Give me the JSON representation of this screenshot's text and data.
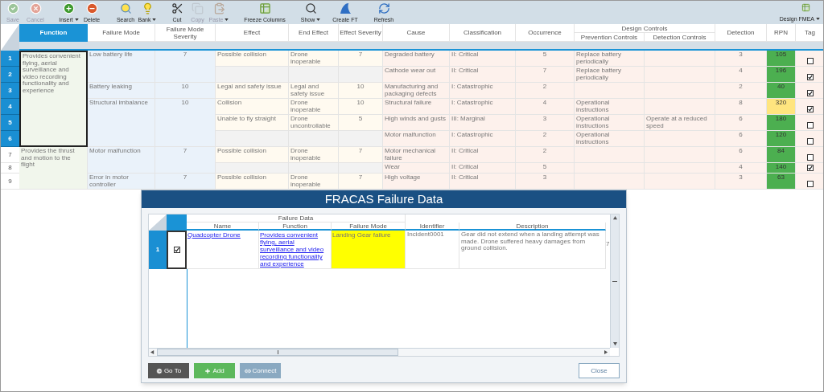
{
  "toolbar": {
    "items": [
      {
        "label": "Save",
        "disabled": true,
        "dropdown": false
      },
      {
        "label": "Cancel",
        "disabled": true,
        "dropdown": false
      },
      {
        "label": "Insert",
        "disabled": false,
        "dropdown": true
      },
      {
        "label": "Delete",
        "disabled": false,
        "dropdown": false
      },
      {
        "label": "Search",
        "disabled": false,
        "dropdown": false
      },
      {
        "label": "Bank",
        "disabled": false,
        "dropdown": true
      },
      {
        "label": "Cut",
        "disabled": false,
        "dropdown": false
      },
      {
        "label": "Copy",
        "disabled": true,
        "dropdown": false
      },
      {
        "label": "Paste",
        "disabled": true,
        "dropdown": true
      },
      {
        "label": "Freeze Columns",
        "disabled": false,
        "dropdown": false
      },
      {
        "label": "Show",
        "disabled": false,
        "dropdown": true
      },
      {
        "label": "Create FT",
        "disabled": false,
        "dropdown": false
      },
      {
        "label": "Refresh",
        "disabled": false,
        "dropdown": false
      }
    ],
    "view_menu": {
      "label": "Design FMEA",
      "dropdown": true
    }
  },
  "table": {
    "columns": [
      "Function",
      "Failure Mode",
      "Failure Mode Severity",
      "Effect",
      "End Effect",
      "Effect Severity",
      "Cause",
      "Classification",
      "Occurrence",
      "Prevention Controls",
      "Detection Controls",
      "Detection",
      "RPN",
      "Tag"
    ],
    "group_header": "Design Controls",
    "functions": [
      {
        "text": "Provides convenient flying, aerial surveillance and video recording functionality and experience",
        "selected": true,
        "failure_modes": [
          {
            "text": "Low battery life",
            "severity": "7",
            "rows": [
              {
                "number": "1",
                "selected": true,
                "effect": {
                  "text": "Possible collision",
                  "end_effect": "Drone inoperable",
                  "severity": "7"
                },
                "cause": "Degraded battery",
                "classification": "II: Critical",
                "occurrence": "5",
                "prevention": "Replace battery periodically",
                "detection": "3",
                "rpn": "105",
                "color": "#4caf50",
                "tagged": false
              },
              {
                "number": "2",
                "selected": true,
                "cause": "Cathode wear out",
                "classification": "II: Critical",
                "occurrence": "7",
                "prevention": "Replace battery periodically",
                "detection": "4",
                "rpn": "196",
                "color": "#4caf50",
                "tagged": true
              }
            ]
          },
          {
            "text": "Battery leaking",
            "severity": "10",
            "rows": [
              {
                "number": "3",
                "selected": true,
                "effect": {
                  "text": "Legal and safety issue",
                  "end_effect": "Legal and safety issue",
                  "severity": "10"
                },
                "cause": "Manufacturing and packaging defects",
                "classification": "I: Catastrophic",
                "occurrence": "2",
                "detection": "2",
                "rpn": "40",
                "color": "#4caf50",
                "tagged": true
              }
            ]
          },
          {
            "text": "Structural imbalance",
            "severity": "10",
            "rows": [
              {
                "number": "4",
                "selected": true,
                "effect": {
                  "text": "Collision",
                  "end_effect": "Drone inoperable",
                  "severity": "10"
                },
                "cause": "Structural failure",
                "classification": "I: Catastrophic",
                "occurrence": "4",
                "prevention": "Operational instructions",
                "detection": "8",
                "rpn": "320",
                "color": "#ffe57f",
                "tagged": true
              },
              {
                "number": "5",
                "selected": true,
                "effect": {
                  "text": "Unable to fly straight",
                  "end_effect": "Drone uncontrollable",
                  "severity": "5"
                },
                "cause": "High winds and gusts",
                "classification": "III: Marginal",
                "occurrence": "3",
                "prevention": "Operational instructions",
                "detection_control": "Operate at a reduced speed",
                "detection": "6",
                "rpn": "180",
                "color": "#4caf50",
                "tagged": false
              },
              {
                "number": "6",
                "selected": true,
                "cause": "Motor malfunction",
                "classification": "I: Catastrophic",
                "occurrence": "2",
                "prevention": "Operational instructions",
                "detection": "6",
                "rpn": "120",
                "color": "#4caf50",
                "tagged": false
              }
            ]
          }
        ]
      },
      {
        "text": "Provides the thrust and motion to the flight",
        "selected": false,
        "failure_modes": [
          {
            "text": "Motor malfunction",
            "severity": "7",
            "rows": [
              {
                "number": "7",
                "selected": false,
                "effect": {
                  "text": "Possible collision",
                  "end_effect": "Drone inoperable",
                  "severity": "7"
                },
                "cause": "Motor mechanical failure",
                "classification": "II: Critical",
                "occurrence": "2",
                "detection": "6",
                "rpn": "84",
                "color": "#4caf50",
                "tagged": false
              },
              {
                "number": "8",
                "selected": false,
                "cause": "Wear",
                "classification": "II: Critical",
                "occurrence": "5",
                "detection": "4",
                "rpn": "140",
                "color": "#4caf50",
                "tagged": true
              }
            ]
          },
          {
            "text": "Error in motor controller",
            "severity": "7",
            "rows": [
              {
                "number": "9",
                "selected": false,
                "effect": {
                  "text": "Possible collision",
                  "end_effect": "Drone inoperable",
                  "severity": "7"
                },
                "cause": "High voltage",
                "classification": "II: Critical",
                "occurrence": "3",
                "detection": "3",
                "rpn": "63",
                "color": "#4caf50",
                "tagged": false
              }
            ]
          }
        ]
      }
    ]
  },
  "dialog": {
    "title": "FRACAS Failure Data",
    "group_header": "Failure Data",
    "columns": [
      "Name",
      "Function",
      "Failure Mode",
      "Identifier",
      "Description"
    ],
    "rows": [
      {
        "number": "1",
        "selected": true,
        "checked": true,
        "name": "Quadcopter Drone",
        "function": "Provides convenient flying, aerial surveillance and video recording functionality and experience",
        "failure_mode": {
          "text": "Landing Gear failure",
          "color": "#ffff00"
        },
        "identifier": "Incident0001",
        "description": "Gear did not extend when a landing attempt was made. Drone suffered heavy damages from ground collision.",
        "column_7": "7"
      }
    ],
    "buttons": [
      {
        "label": "Go To",
        "kind": "goto"
      },
      {
        "label": "Add",
        "kind": "add"
      },
      {
        "label": "Connect",
        "kind": "connect"
      },
      {
        "label": "Close",
        "kind": "close"
      }
    ]
  }
}
